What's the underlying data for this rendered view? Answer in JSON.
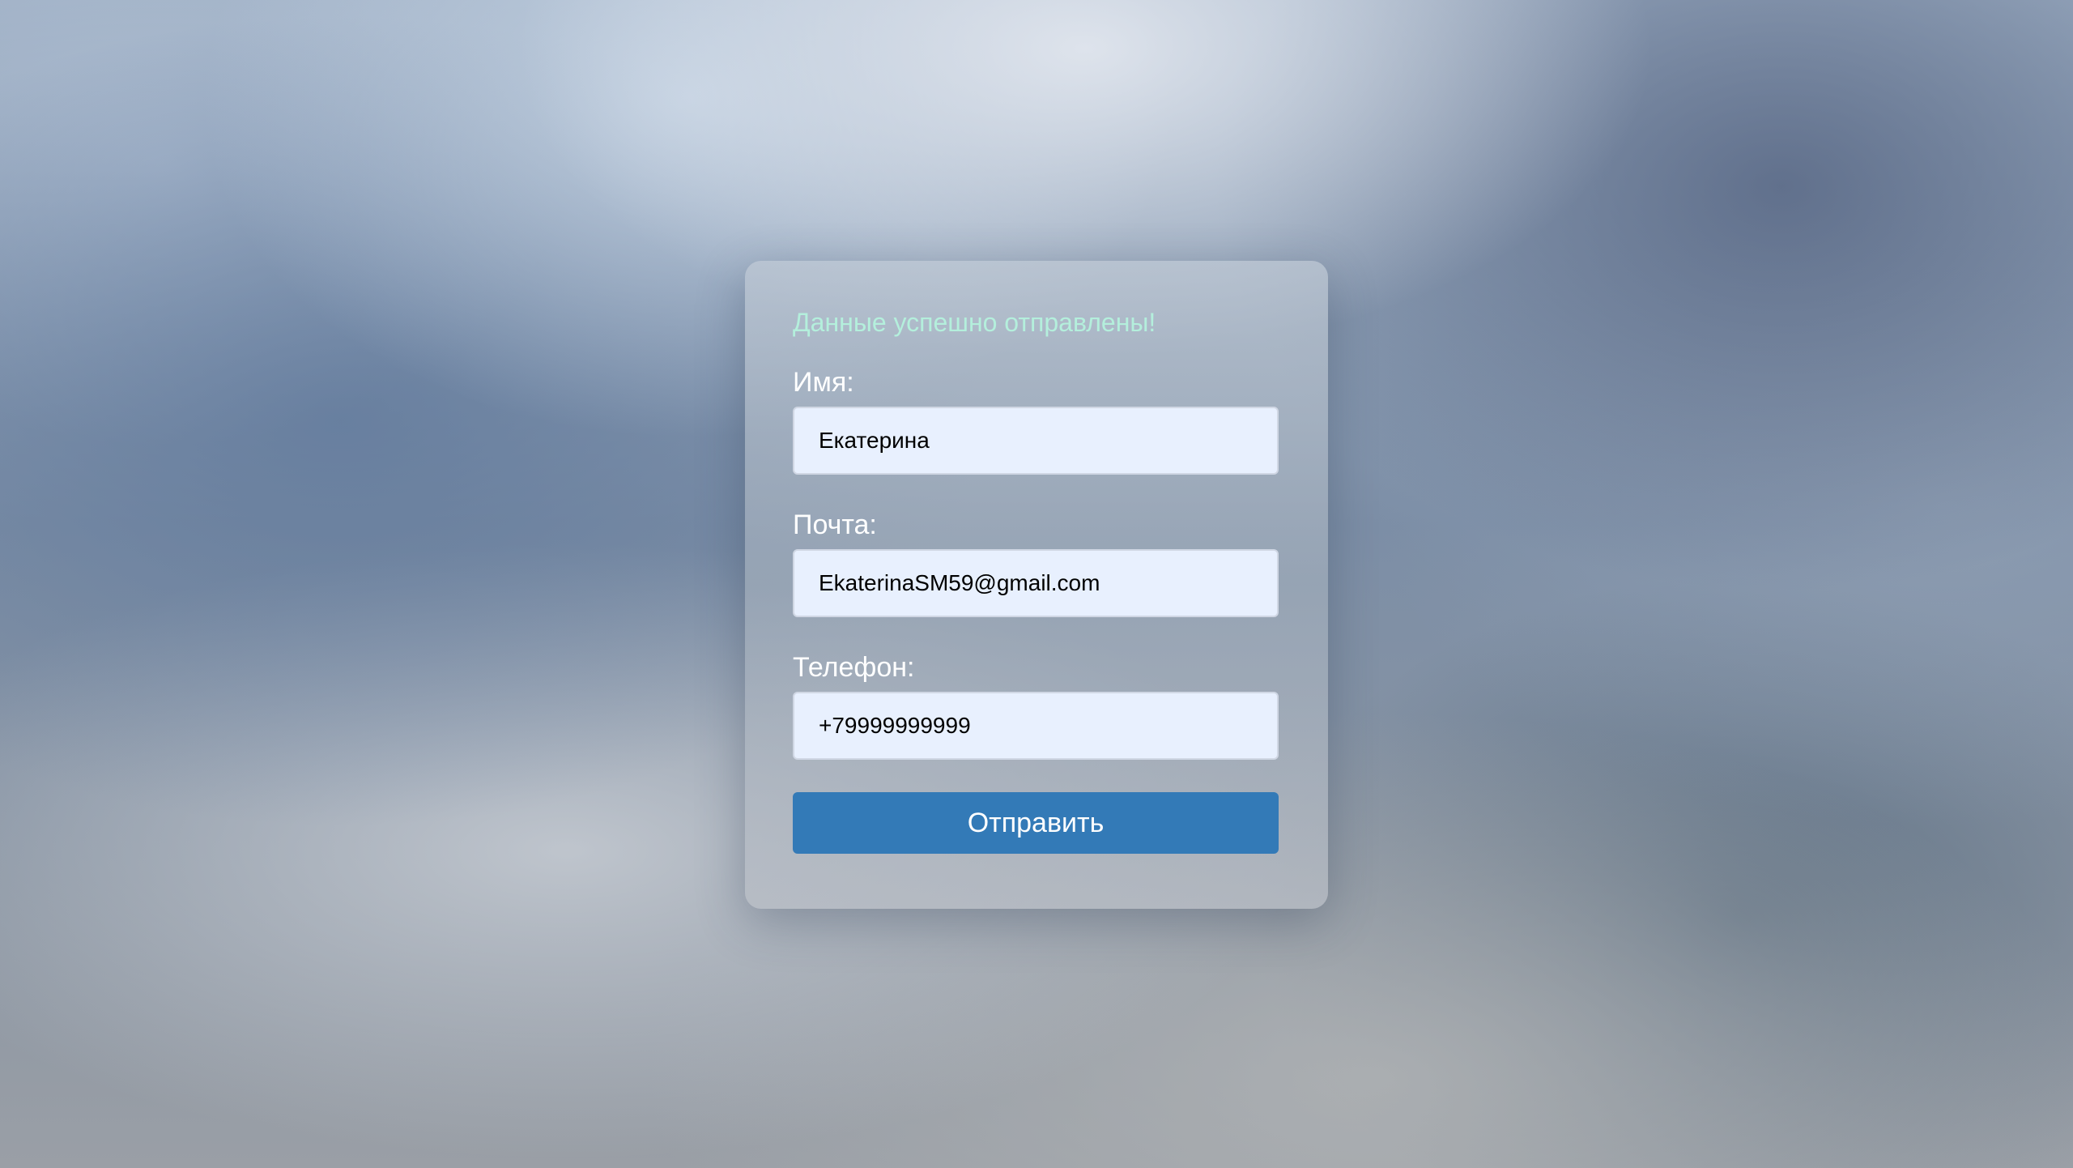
{
  "form": {
    "success_message": "Данные успешно отправлены!",
    "fields": [
      {
        "label": "Имя:",
        "value": "Екатерина"
      },
      {
        "label": "Почта:",
        "value": "EkaterinaSM59@gmail.com"
      },
      {
        "label": "Телефон:",
        "value": "+79999999999"
      }
    ],
    "submit_label": "Отправить"
  },
  "colors": {
    "success_text": "#b4efdc",
    "button_background": "#337ab7",
    "input_background": "#e8f0fe"
  }
}
